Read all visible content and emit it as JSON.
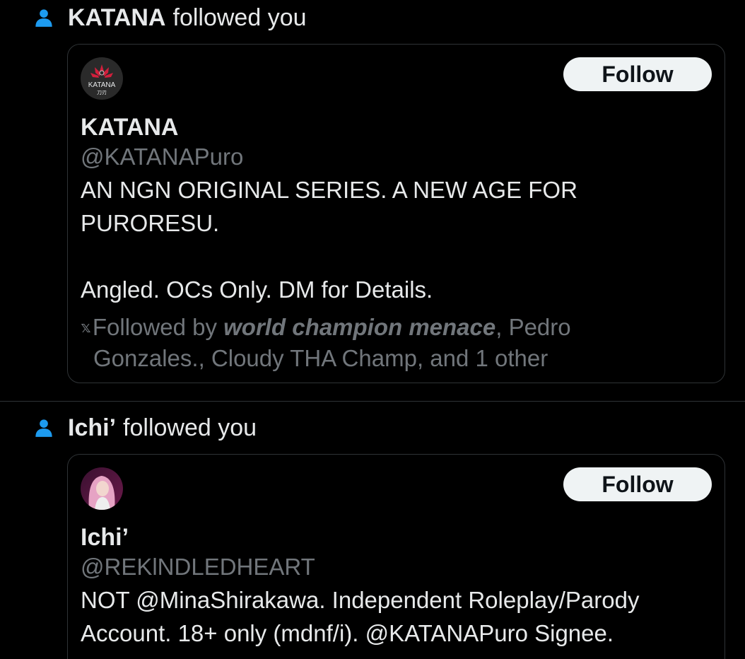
{
  "notifications": [
    {
      "header_name": "KATANA",
      "header_action": "followed you",
      "card": {
        "display_name": "KATANA",
        "handle": "@KATANAPuro",
        "follow_label": "Follow",
        "bio_line1": "AN NGN ORIGINAL SERIES. A NEW AGE FOR",
        "bio_line2": "PURORESU.",
        "bio_line3": "Angled. OCs Only. DM for Details.",
        "followed_by_prefix": "Followed by ",
        "followed_by_bold": "world champion menace",
        "followed_by_rest1": ", Pedro",
        "followed_by_rest2": "Gonzales., Cloudy THA Champ, and 1 other",
        "followed_by_glyph": "𝕩",
        "avatar_text": "KATANA",
        "avatar_subtext": "刀刃"
      }
    },
    {
      "header_name": "Ichi’",
      "header_action": "followed you",
      "card": {
        "display_name": "Ichi’",
        "handle": "@REKlNDLEDHEART",
        "follow_label": "Follow",
        "bio_line1": "NOT @MinaShirakawa. Independent Roleplay/Parody",
        "bio_line2": "Account. 18+ only (mdnf/i). @KATANAPuro Signee."
      }
    }
  ],
  "colors": {
    "background": "#000000",
    "text_primary": "#e7e9ea",
    "text_secondary": "#71767b",
    "border": "#2f3336",
    "icon_blue": "#1d9bf0",
    "follow_bg": "#eff3f4",
    "brand_red": "#d21f3c"
  }
}
